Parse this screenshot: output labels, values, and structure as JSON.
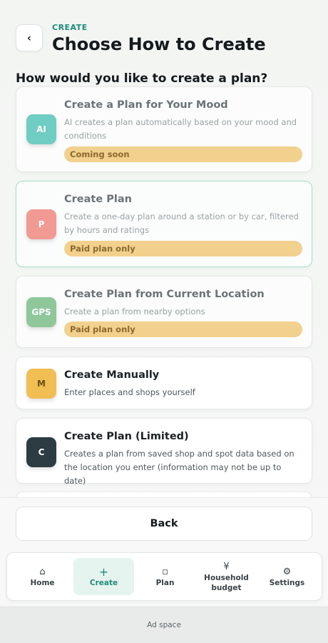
{
  "header": {
    "eyebrow": "CREATE",
    "title": "Choose How to Create",
    "back_glyph": "‹"
  },
  "question": "How would you like to create a plan?",
  "options": [
    {
      "icon_text": "AI",
      "title": "Create a Plan for Your Mood",
      "desc": "AI creates a plan automatically based on your mood and conditions",
      "status": "Coming soon",
      "icon_color": "#6fcdc3"
    },
    {
      "icon_text": "P",
      "title": "Create Plan",
      "desc": "Create a one-day plan around a station or by car, filtered by hours and ratings",
      "status": "Paid plan only",
      "icon_color": "#f09a93"
    },
    {
      "icon_text": "GPS",
      "title": "Create Plan from Current Location",
      "desc": "Create a plan from nearby options",
      "status": "Paid plan only",
      "icon_color": "#8fc79b"
    },
    {
      "icon_text": "M",
      "title": "Create Manually",
      "desc": "Enter places and shops yourself",
      "status": "",
      "icon_color": "#f0be52"
    },
    {
      "icon_text": "C",
      "title": "Create Plan (Limited)",
      "desc": "Creates a plan from saved shop and spot data based on the location you enter (information may not be up to date)",
      "status": "",
      "icon_color": "#2d3c42"
    }
  ],
  "back_button": "Back",
  "tabs": [
    {
      "icon": "⌂",
      "label": "Home"
    },
    {
      "icon": "+",
      "label": "Create"
    },
    {
      "icon": "▫",
      "label": "Plan"
    },
    {
      "icon": "¥",
      "label": "Household budget"
    },
    {
      "icon": "⚙",
      "label": "Settings"
    }
  ],
  "ad_text": "Ad space",
  "colors": {
    "accent": "#1d8c78",
    "status_pill": "#f2d08e"
  }
}
